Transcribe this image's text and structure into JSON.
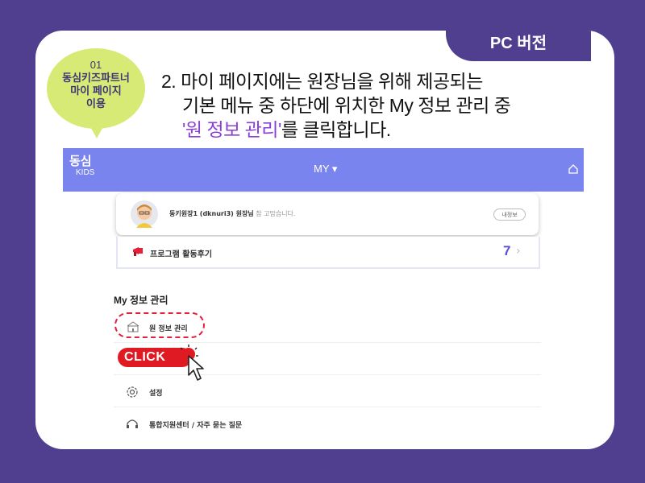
{
  "header_tab": {
    "label": "PC 버전"
  },
  "bubble": {
    "number": "01",
    "line1": "동심키즈파트너",
    "line2": "마이 페이지",
    "line3": "이용"
  },
  "instruction": {
    "line1": "2. 마이 페이지에는 원장님을 위해 제공되는",
    "line2": "기본 메뉴 중 하단에 위치한 My 정보 관리 중",
    "line3_highlight": "'원 정보 관리'",
    "line3_rest": "를 클릭합니다."
  },
  "app": {
    "logo": "동심",
    "logo_sub": "KIDS",
    "menu_label": "MY ▾",
    "home_icon": "home-icon",
    "profile": {
      "name_bold": "동키원장1 (dknuri3) 원장님",
      "name_rest": " 참 고맙습니다.",
      "my_info_button": "내정보"
    },
    "review": {
      "label": "프로그램 활동후기",
      "count": "7",
      "chevron": "›"
    },
    "section_title": "My 정보 관리",
    "menu_items": [
      {
        "label": "원 정보 관리",
        "icon": "school-icon"
      },
      {
        "label": "",
        "icon": ""
      },
      {
        "label": "설정",
        "icon": "gear-icon"
      },
      {
        "label": "통합지원센터 / 자주 묻는 질문",
        "icon": "headset-icon"
      }
    ]
  },
  "click_badge": {
    "label": "CLICK"
  },
  "colors": {
    "background": "#4f3f8e",
    "topbar": "#7a84ee",
    "bubble": "#d8ea76",
    "highlight": "#8a3fd6",
    "click_red": "#e01a22"
  }
}
